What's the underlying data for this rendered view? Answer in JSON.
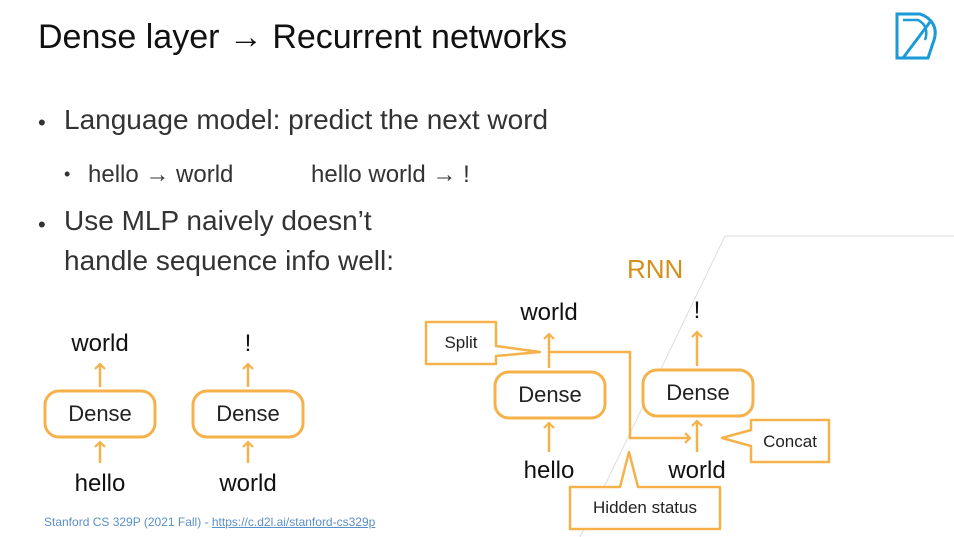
{
  "slide": {
    "title": "Dense layer → Recurrent networks",
    "bullets": [
      "Language model: predict the next word",
      "hello → world",
      "hello world → !",
      "Use MLP naively doesn’t",
      "handle sequence info well:"
    ],
    "footer_text": "Stanford CS 329P (2021 Fall) - ",
    "footer_link": "https://c.d2l.ai/stanford-cs329p"
  },
  "mlp": {
    "left": {
      "output": "world",
      "box": "Dense",
      "input": "hello"
    },
    "right": {
      "output": "!",
      "box": "Dense",
      "input": "world"
    }
  },
  "rnn": {
    "label": "RNN",
    "left": {
      "output": "world",
      "box": "Dense",
      "input": "hello"
    },
    "right": {
      "output": "!",
      "box": "Dense",
      "input": "world"
    },
    "callouts": {
      "split": "Split",
      "concat": "Concat",
      "hidden": "Hidden status"
    }
  },
  "colors": {
    "accent_orange": "#f5b24a",
    "rnn_label": "#d4901a",
    "logo_blue": "#1a9ad6",
    "footer_blue": "#5b8fc7"
  },
  "icons": {
    "logo": "d2l-logo-icon",
    "bullet": "bullet-dot-icon",
    "arrow": "arrow-up-icon"
  }
}
